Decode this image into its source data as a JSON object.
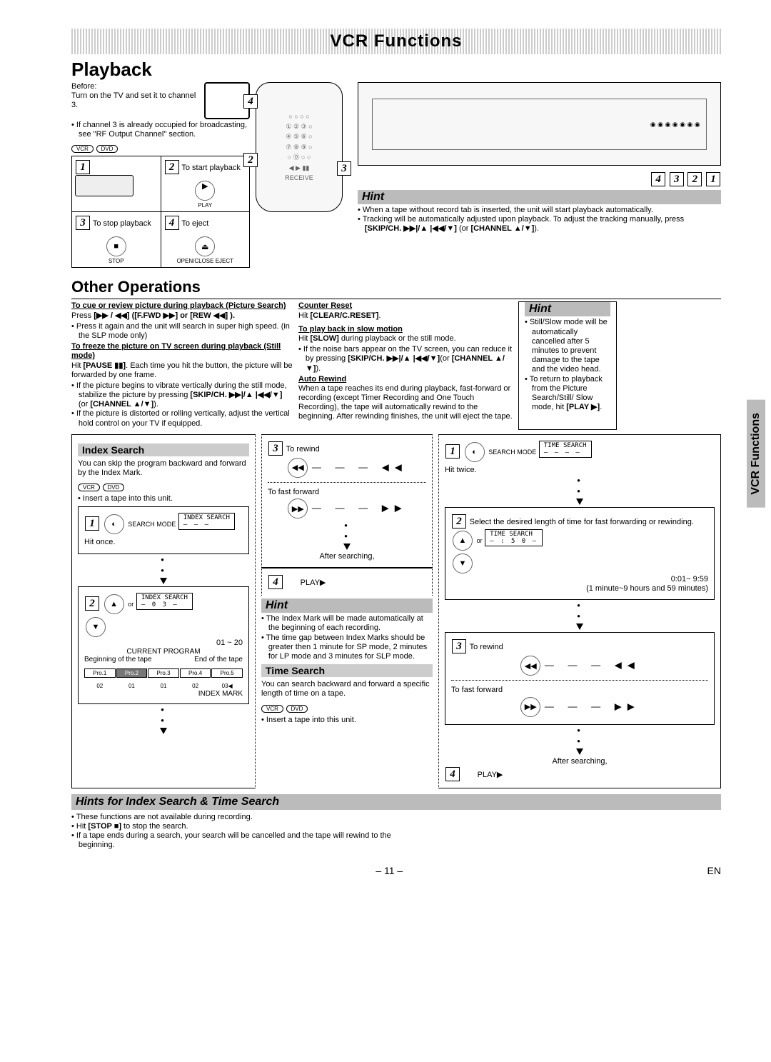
{
  "header": {
    "title": "VCR Functions"
  },
  "playback": {
    "title": "Playback",
    "before_label": "Before:",
    "before_text": "Turn on the TV and set it to channel 3.",
    "before_note": "If channel 3 is already occupied for broadcasting, see \"RF Output Channel\" section.",
    "step2": "To start playback",
    "step2_btn": "PLAY",
    "step3": "To stop playback",
    "step3_btn": "STOP",
    "step4": "To eject",
    "step4_btn": "OPEN/CLOSE EJECT"
  },
  "hint1": {
    "label": "Hint",
    "b1": "When a tape without record tab is inserted, the unit will start playback automatically.",
    "b2_a": "Tracking will be automatically adjusted upon playback. To adjust the tracking manually, press ",
    "b2_b": "[SKIP/CH. ▶▶|/▲ |◀◀/▼]",
    "b2_c": " (or ",
    "b2_d": "[CHANNEL ▲/▼]",
    "b2_e": ")."
  },
  "other": {
    "title": "Other Operations"
  },
  "colL": {
    "h1": "To cue or review picture during playback (Picture Search)",
    "t1a": "Press ",
    "t1_btns": "[▶▶ / ◀◀] ([F.FWD ▶▶] or [REW ◀◀] ).",
    "t1b": "Press it again and the unit will search in super high speed. (in the SLP mode only)",
    "h2": "To freeze the picture on TV screen during playback (Still mode)",
    "t2a": "Hit ",
    "t2a_btn": "[PAUSE ▮▮]",
    "t2a2": ". Each time you hit the button, the picture will be forwarded by one frame.",
    "b1": "If the picture begins to vibrate vertically during the still mode, stabilize the picture by pressing ",
    "b1_btn": "[SKIP/CH. ▶▶|/▲ |◀◀/▼]",
    "b1_c": " (or ",
    "b1_btn2": "[CHANNEL ▲/▼]",
    "b1_e": ").",
    "b2": "If the picture is distorted or rolling vertically, adjust the vertical hold control on your TV if equipped."
  },
  "colM": {
    "h1": "Counter Reset",
    "t1": "Hit ",
    "t1_btn": "[CLEAR/C.RESET]",
    "t1_end": ".",
    "h2": "To play back in slow motion",
    "t2": "Hit ",
    "t2_btn": "[SLOW]",
    "t2_end": " during playback or the still mode.",
    "b1_a": "If the noise bars appear on the TV screen, you can reduce it by pressing ",
    "b1_btn": "[SKIP/CH. ▶▶|/▲ |◀◀/▼]",
    "b1_c": "(or ",
    "b1_btn2": "[CHANNEL ▲/▼]",
    "b1_e": ").",
    "h3": "Auto Rewind",
    "t3": "When a tape reaches its end during playback, fast-forward or recording (except Timer Recording and One Touch Recording), the tape will automatically rewind to the beginning. After rewinding finishes, the unit will eject the tape."
  },
  "hintR": {
    "label": "Hint",
    "b1": "Still/Slow mode will be automatically cancelled after 5 minutes to prevent damage to the tape and the video head.",
    "b2a": "To return to playback from the Picture Search/Still/ Slow mode, hit ",
    "b2_btn": "[PLAY ▶]",
    "b2_end": "."
  },
  "index": {
    "title": "Index Search",
    "intro": "You can skip the program backward and forward by the Index Mark.",
    "insert": "Insert a tape into this unit.",
    "step1_btn": "SEARCH MODE",
    "step1_lcd": "INDEX SEARCH",
    "step1_hit": "Hit once.",
    "step2_lcd": "INDEX SEARCH",
    "step2_val": "0 3",
    "step2_range": "01 ~ 20",
    "prog_label": "CURRENT PROGRAM",
    "beg": "Beginning of the tape",
    "end": "End of the tape",
    "pro": [
      "Pro.1",
      "Pro.2",
      "Pro.3",
      "Pro.4",
      "Pro.5"
    ],
    "pronums": [
      "02",
      "01",
      "01",
      "02",
      "03◀"
    ],
    "mark": "INDEX MARK"
  },
  "panel3": {
    "rw": "To rewind",
    "ff": "To fast forward",
    "after": "After searching,",
    "play": "PLAY▶"
  },
  "hint2": {
    "label": "Hint",
    "b1": "The Index Mark will be made automatically at the beginning of each recording.",
    "b2": "The time gap between Index Marks should be greater then 1 minute for SP mode, 2 minutes for LP mode and 3 minutes for SLP mode."
  },
  "time": {
    "title": "Time Search",
    "intro": "You can search backward and forward a specific length of time on a tape.",
    "insert": "Insert a tape into this unit."
  },
  "hints_combo": {
    "title": "Hints for Index Search & Time Search",
    "b1": "These functions are not available during recording.",
    "b2a": "Hit ",
    "b2_btn": "[STOP ■]",
    "b2b": " to stop the search.",
    "b3": "If a tape ends during a search, your search will be cancelled and the tape will rewind to the beginning."
  },
  "ts_panel": {
    "step1_btn": "SEARCH MODE",
    "step1_lcd": "TIME SEARCH",
    "step1_hit": "Hit twice.",
    "step2": "Select the desired length of time for fast forwarding or rewinding.",
    "step2_lcd": "TIME SEARCH",
    "step2_val": ": 5 0",
    "range": "0:01~ 9:59",
    "range2": "(1 minute~9 hours and 59 minutes)",
    "rw": "To rewind",
    "ff": "To fast forward",
    "after": "After searching,",
    "play": "PLAY▶"
  },
  "tab": {
    "label": "VCR Functions"
  },
  "footer": {
    "page": "– 11 –",
    "lang": "EN"
  }
}
